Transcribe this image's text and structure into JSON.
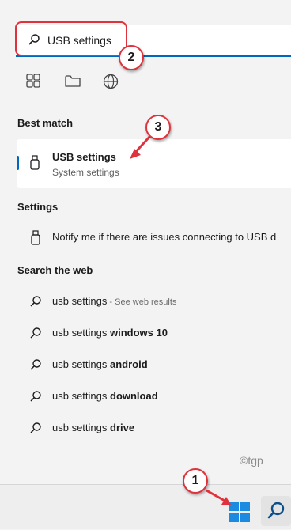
{
  "search": {
    "query": "USB settings"
  },
  "filters": [
    {
      "icon": "apps-icon"
    },
    {
      "icon": "folder-icon"
    },
    {
      "icon": "globe-icon"
    }
  ],
  "best_match": {
    "title": "Best match",
    "item": {
      "name": "USB settings",
      "type": "System settings",
      "icon": "usb-icon"
    }
  },
  "settings": {
    "title": "Settings",
    "item": {
      "label": "Notify me if there are issues connecting to USB d",
      "icon": "usb-icon"
    }
  },
  "web": {
    "title": "Search the web",
    "items": [
      {
        "prefix": "usb settings",
        "suffix": "",
        "note": " - See web results"
      },
      {
        "prefix": "usb settings ",
        "suffix": "windows 10",
        "note": ""
      },
      {
        "prefix": "usb settings ",
        "suffix": "android",
        "note": ""
      },
      {
        "prefix": "usb settings ",
        "suffix": "download",
        "note": ""
      },
      {
        "prefix": "usb settings ",
        "suffix": "drive",
        "note": ""
      }
    ]
  },
  "annotations": {
    "step1": "1",
    "step2": "2",
    "step3": "3"
  },
  "watermark": "©tgp",
  "colors": {
    "accent": "#0067c0",
    "annotation": "#e0323c",
    "start_blue": "#1a8be0"
  }
}
